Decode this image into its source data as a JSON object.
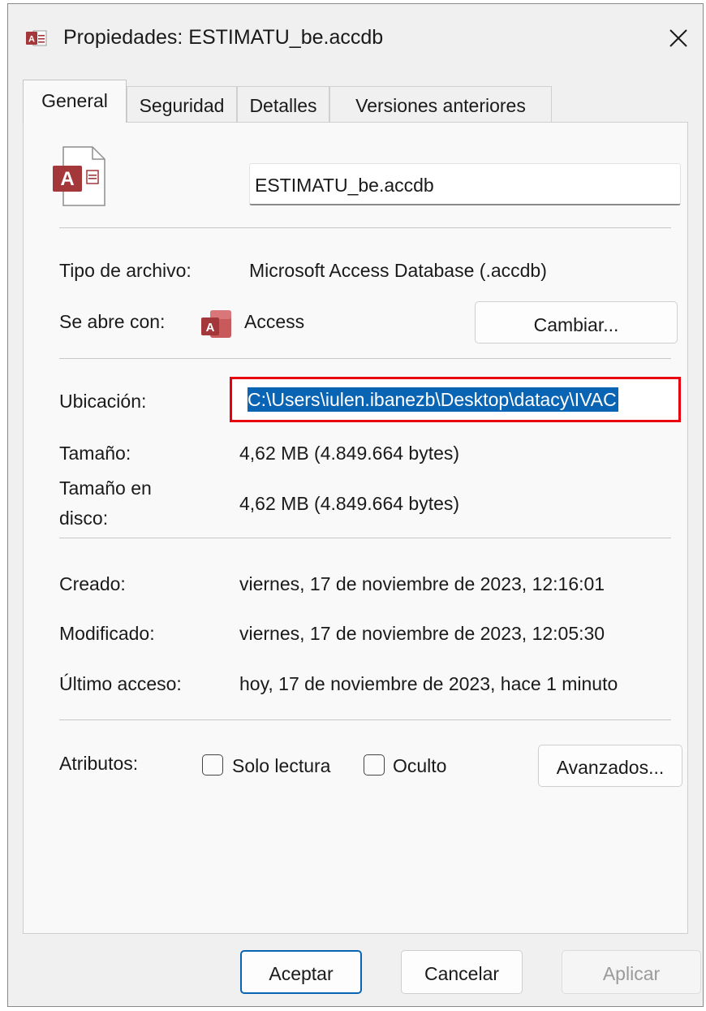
{
  "window": {
    "title": "Propiedades: ESTIMATU_be.accdb",
    "app_icon": "access-file-icon",
    "close_glyph": "✕"
  },
  "tabs": [
    {
      "label": "General",
      "active": true
    },
    {
      "label": "Seguridad",
      "active": false
    },
    {
      "label": "Detalles",
      "active": false
    },
    {
      "label": "Versiones anteriores",
      "active": false
    }
  ],
  "general": {
    "file_icon": "access-file-icon",
    "file_icon_letter": "A",
    "filename": "ESTIMATU_be.accdb",
    "type_label": "Tipo de archivo:",
    "type_value": "Microsoft Access Database (.accdb)",
    "opens_with_label": "Se abre con:",
    "opens_with_icon_letter": "A",
    "opens_with_value": "Access",
    "change_button": "Cambiar...",
    "location_label": "Ubicación:",
    "location_value": "C:\\Users\\iulen.ibanezb\\Desktop\\datacy\\IVAC",
    "size_label": "Tamaño:",
    "size_value": "4,62 MB (4.849.664 bytes)",
    "disk_size_label_line1": "Tamaño en",
    "disk_size_label_line2": "disco:",
    "disk_size_value": "4,62 MB (4.849.664 bytes)",
    "created_label": "Creado:",
    "created_value": "viernes, 17 de noviembre de 2023, 12:16:01",
    "modified_label": "Modificado:",
    "modified_value": "viernes, 17 de noviembre de 2023, 12:05:30",
    "accessed_label": "Último acceso:",
    "accessed_value": "hoy, 17 de noviembre de 2023, hace 1 minuto",
    "attributes_label": "Atributos:",
    "readonly_label": "Solo lectura",
    "readonly_checked": false,
    "hidden_label": "Oculto",
    "hidden_checked": false,
    "advanced_button": "Avanzados..."
  },
  "footer": {
    "ok": "Aceptar",
    "cancel": "Cancelar",
    "apply": "Aplicar"
  },
  "colors": {
    "access_red": "#a4373a",
    "selection_blue": "#0a64b4",
    "highlight_red": "#e8000f"
  }
}
